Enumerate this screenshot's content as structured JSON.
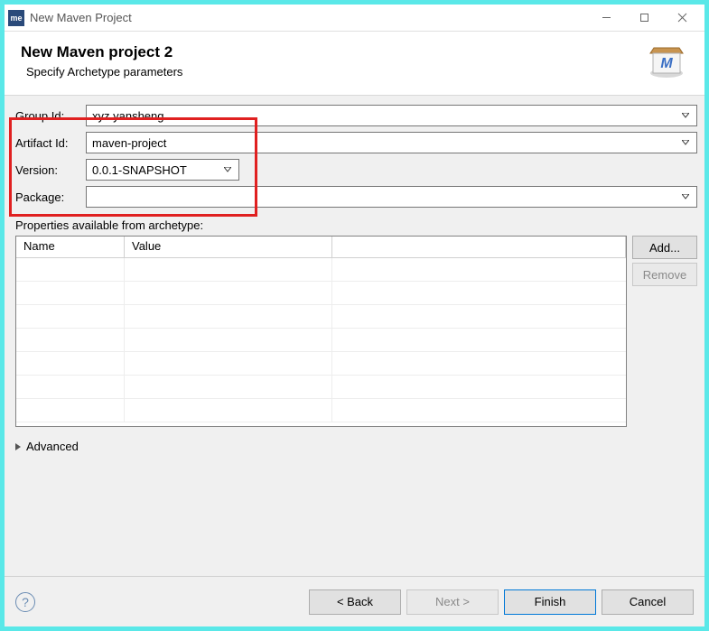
{
  "window": {
    "title": "New Maven Project",
    "icon_label": "me"
  },
  "header": {
    "title": "New Maven project 2",
    "subtitle": "Specify Archetype parameters"
  },
  "form": {
    "group_id_label": "Group Id:",
    "group_id_value": "xyz.yansheng",
    "artifact_id_label": "Artifact Id:",
    "artifact_id_value": "maven-project",
    "version_label": "Version:",
    "version_value": "0.0.1-SNAPSHOT",
    "package_label": "Package:",
    "package_value": ""
  },
  "properties": {
    "section_label": "Properties available from archetype:",
    "col_name": "Name",
    "col_value": "Value",
    "add_label": "Add...",
    "remove_label": "Remove"
  },
  "advanced": {
    "label": "Advanced"
  },
  "footer": {
    "back": "< Back",
    "next": "Next >",
    "finish": "Finish",
    "cancel": "Cancel"
  }
}
